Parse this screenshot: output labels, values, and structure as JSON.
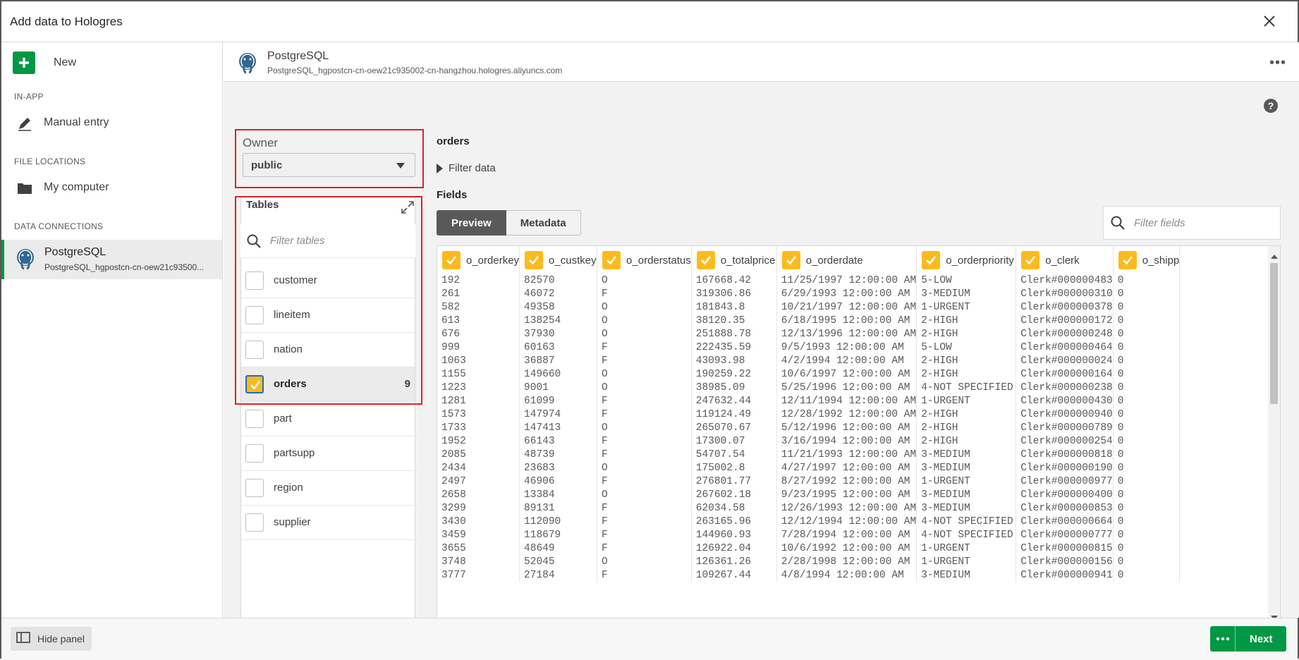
{
  "window": {
    "title": "Add data to Hologres"
  },
  "sidebar": {
    "new_label": "New",
    "sections": {
      "in_app": "IN-APP",
      "file_locations": "FILE LOCATIONS",
      "data_connections": "DATA CONNECTIONS"
    },
    "manual_entry": "Manual entry",
    "my_computer": "My computer",
    "connection": {
      "name": "PostgreSQL",
      "subtitle": "PostgreSQL_hgpostcn-cn-oew21c93500..."
    }
  },
  "header": {
    "name": "PostgreSQL",
    "subtitle": "PostgreSQL_hgpostcn-cn-oew21c935002-cn-hangzhou.hologres.aliyuncs.com",
    "more_label": "•••"
  },
  "help_label": "?",
  "owner": {
    "label": "Owner",
    "value": "public"
  },
  "tables": {
    "title": "Tables",
    "filter_placeholder": "Filter tables",
    "items": [
      {
        "name": "customer",
        "selected": false,
        "count": ""
      },
      {
        "name": "lineitem",
        "selected": false,
        "count": ""
      },
      {
        "name": "nation",
        "selected": false,
        "count": ""
      },
      {
        "name": "orders",
        "selected": true,
        "count": "9"
      },
      {
        "name": "part",
        "selected": false,
        "count": ""
      },
      {
        "name": "partsupp",
        "selected": false,
        "count": ""
      },
      {
        "name": "region",
        "selected": false,
        "count": ""
      },
      {
        "name": "supplier",
        "selected": false,
        "count": ""
      }
    ]
  },
  "preview": {
    "table_name": "orders",
    "filter_data_label": "Filter data",
    "fields_title": "Fields",
    "tabs": [
      "Preview",
      "Metadata"
    ],
    "fields_filter_placeholder": "Filter fields",
    "columns": [
      "o_orderkey",
      "o_custkey",
      "o_orderstatus",
      "o_totalprice",
      "o_orderdate",
      "o_orderpriority",
      "o_clerk",
      "o_shipp"
    ],
    "rows": [
      [
        "192",
        "82570",
        "O",
        "167668.42",
        "11/25/1997 12:00:00 AM",
        "5-LOW",
        "Clerk#000000483",
        "0"
      ],
      [
        "261",
        "46072",
        "F",
        "319306.86",
        "6/29/1993 12:00:00 AM",
        "3-MEDIUM",
        "Clerk#000000310",
        "0"
      ],
      [
        "582",
        "49358",
        "O",
        "181843.8",
        "10/21/1997 12:00:00 AM",
        "1-URGENT",
        "Clerk#000000378",
        "0"
      ],
      [
        "613",
        "138254",
        "O",
        "38120.35",
        "6/18/1995 12:00:00 AM",
        "2-HIGH",
        "Clerk#000000172",
        "0"
      ],
      [
        "676",
        "37930",
        "O",
        "251888.78",
        "12/13/1996 12:00:00 AM",
        "2-HIGH",
        "Clerk#000000248",
        "0"
      ],
      [
        "999",
        "60163",
        "F",
        "222435.59",
        "9/5/1993 12:00:00 AM",
        "5-LOW",
        "Clerk#000000464",
        "0"
      ],
      [
        "1063",
        "36887",
        "F",
        "43093.98",
        "4/2/1994 12:00:00 AM",
        "2-HIGH",
        "Clerk#000000024",
        "0"
      ],
      [
        "1155",
        "149660",
        "O",
        "190259.22",
        "10/6/1997 12:00:00 AM",
        "2-HIGH",
        "Clerk#000000164",
        "0"
      ],
      [
        "1223",
        "9001",
        "O",
        "38985.09",
        "5/25/1996 12:00:00 AM",
        "4-NOT SPECIFIED",
        "Clerk#000000238",
        "0"
      ],
      [
        "1281",
        "61099",
        "F",
        "247632.44",
        "12/11/1994 12:00:00 AM",
        "1-URGENT",
        "Clerk#000000430",
        "0"
      ],
      [
        "1573",
        "147974",
        "F",
        "119124.49",
        "12/28/1992 12:00:00 AM",
        "2-HIGH",
        "Clerk#000000940",
        "0"
      ],
      [
        "1733",
        "147413",
        "O",
        "265070.67",
        "5/12/1996 12:00:00 AM",
        "2-HIGH",
        "Clerk#000000789",
        "0"
      ],
      [
        "1952",
        "66143",
        "F",
        "17300.07",
        "3/16/1994 12:00:00 AM",
        "2-HIGH",
        "Clerk#000000254",
        "0"
      ],
      [
        "2085",
        "48739",
        "F",
        "54707.54",
        "11/21/1993 12:00:00 AM",
        "3-MEDIUM",
        "Clerk#000000818",
        "0"
      ],
      [
        "2434",
        "23683",
        "O",
        "175002.8",
        "4/27/1997 12:00:00 AM",
        "3-MEDIUM",
        "Clerk#000000190",
        "0"
      ],
      [
        "2497",
        "46906",
        "F",
        "276801.77",
        "8/27/1992 12:00:00 AM",
        "1-URGENT",
        "Clerk#000000977",
        "0"
      ],
      [
        "2658",
        "13384",
        "O",
        "267602.18",
        "9/23/1995 12:00:00 AM",
        "3-MEDIUM",
        "Clerk#000000400",
        "0"
      ],
      [
        "3299",
        "89131",
        "F",
        "62034.58",
        "12/26/1993 12:00:00 AM",
        "3-MEDIUM",
        "Clerk#000000853",
        "0"
      ],
      [
        "3430",
        "112090",
        "F",
        "263165.96",
        "12/12/1994 12:00:00 AM",
        "4-NOT SPECIFIED",
        "Clerk#000000664",
        "0"
      ],
      [
        "3459",
        "118679",
        "F",
        "144960.93",
        "7/28/1994 12:00:00 AM",
        "4-NOT SPECIFIED",
        "Clerk#000000777",
        "0"
      ],
      [
        "3655",
        "48649",
        "F",
        "126922.04",
        "10/6/1992 12:00:00 AM",
        "1-URGENT",
        "Clerk#000000815",
        "0"
      ],
      [
        "3748",
        "52045",
        "O",
        "126361.26",
        "2/28/1998 12:00:00 AM",
        "1-URGENT",
        "Clerk#000000156",
        "0"
      ],
      [
        "3777",
        "27184",
        "F",
        "109267.44",
        "4/8/1994 12:00:00 AM",
        "3-MEDIUM",
        "Clerk#000000941",
        "0"
      ]
    ]
  },
  "footer": {
    "hide_panel_label": "Hide panel",
    "next_label": "Next"
  },
  "colors": {
    "accent": "#009845",
    "checkbox": "#fbbb1e",
    "highlight": "#e0202a"
  }
}
